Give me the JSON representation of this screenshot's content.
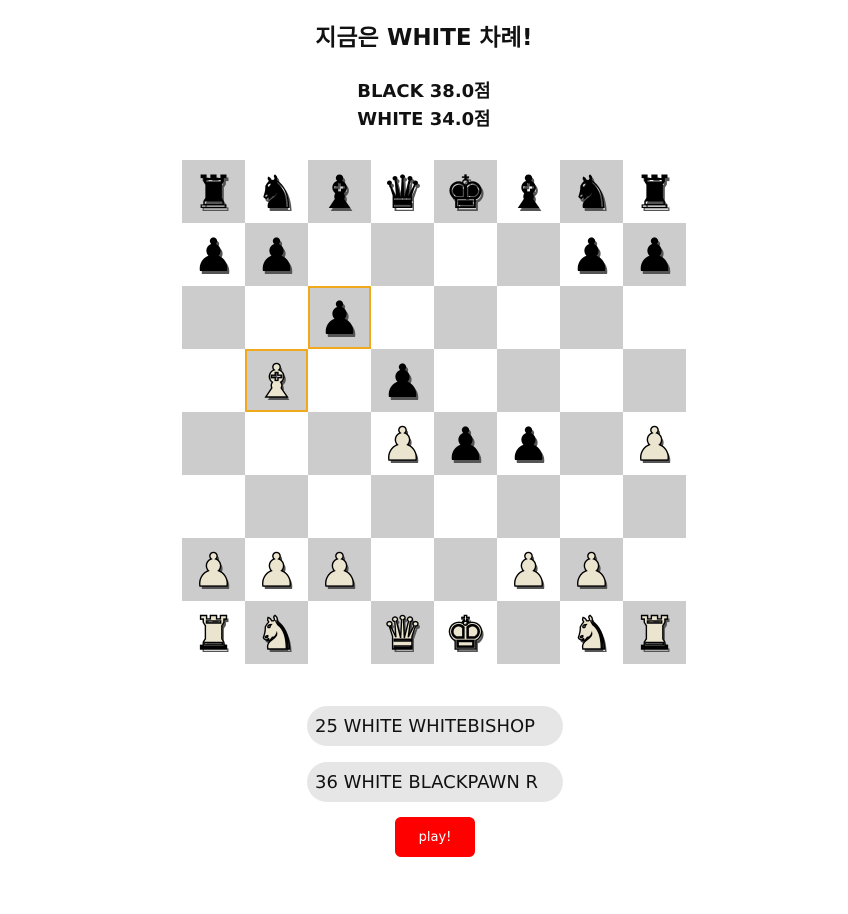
{
  "header": {
    "turn_text": "지금은 WHITE 차례!"
  },
  "scores": {
    "black": "BLACK 38.0점",
    "white": "WHITE 34.0점"
  },
  "board": {
    "rows": [
      [
        "bR",
        "bN",
        "bB",
        "bQ",
        "bK",
        "bB",
        "bN",
        "bR"
      ],
      [
        "bP",
        "bP",
        "",
        "",
        "",
        "",
        "bP",
        "bP"
      ],
      [
        "",
        "",
        "bP",
        "",
        "",
        "",
        "",
        ""
      ],
      [
        "",
        "wB",
        "",
        "bP",
        "",
        "",
        "",
        ""
      ],
      [
        "",
        "",
        "",
        "wP",
        "bP",
        "bP",
        "",
        "wP"
      ],
      [
        "",
        "",
        "",
        "",
        "",
        "",
        "",
        ""
      ],
      [
        "wP",
        "wP",
        "wP",
        "",
        "",
        "wP",
        "wP",
        ""
      ],
      [
        "wR",
        "wN",
        "",
        "wQ",
        "wK",
        "",
        "wN",
        "wR"
      ]
    ],
    "highlighted": [
      [
        2,
        2
      ],
      [
        3,
        1
      ]
    ],
    "highlight_color": "#f0a81c",
    "dark_square_color": "#cccccc",
    "light_square_color": "#ffffff"
  },
  "moves": {
    "input1_value": "25 WHITE WHITEBISHOP",
    "input2_value": "36 WHITE BLACKPAWN R"
  },
  "play_button": {
    "label": "play!",
    "color": "#ff0000"
  }
}
